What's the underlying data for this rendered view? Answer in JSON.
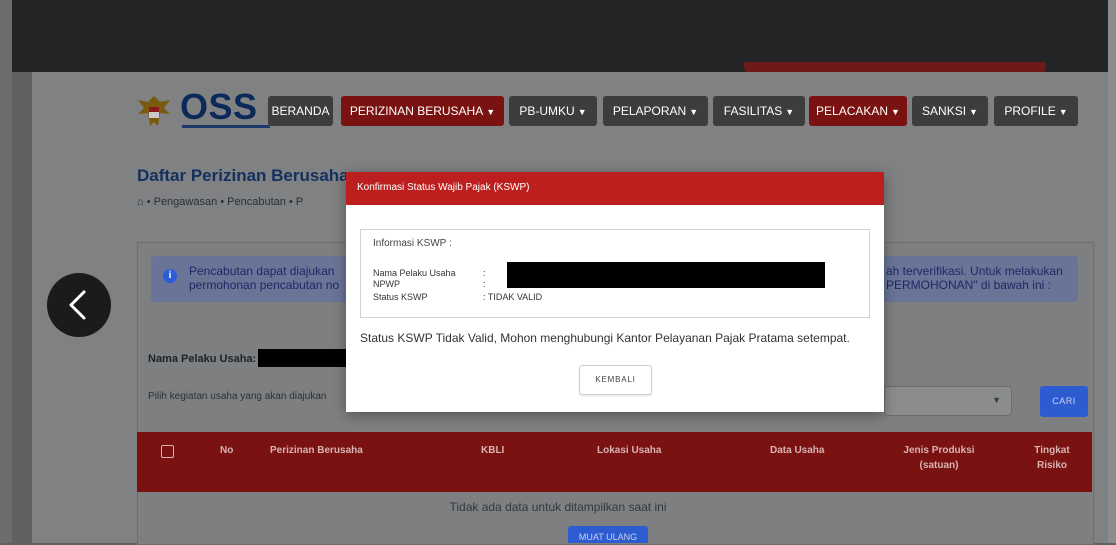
{
  "nav": {
    "items": [
      {
        "label": "BERANDA",
        "caret": false
      },
      {
        "label": "PERIZINAN BERUSAHA",
        "caret": true
      },
      {
        "label": "PB-UMKU",
        "caret": true
      },
      {
        "label": "PELAPORAN",
        "caret": true
      },
      {
        "label": "FASILITAS",
        "caret": true
      },
      {
        "label": "PELACAKAN",
        "caret": true
      },
      {
        "label": "SANKSI",
        "caret": true
      },
      {
        "label": "PROFILE",
        "caret": true
      }
    ],
    "logo_text": "OSS"
  },
  "page": {
    "title": "Daftar Perizinan Berusaha",
    "breadcrumb": "⌂ • Pengawasan • Pencabutan • P",
    "info_left_line1": "Pencabutan dapat diajukan",
    "info_left_line2": "permohonan pencabutan no",
    "info_right_line1": "ah terverifikasi. Untuk melakukan",
    "info_right_line2": "PERMOHONAN\" di bawah ini :",
    "nama_label": "Nama Pelaku Usaha:",
    "pilih_label": "Pilih kegiatan usaha yang akan diajukan",
    "cari_label": "CARI",
    "table_headers": [
      "No",
      "Perizinan Berusaha",
      "KBLI",
      "Lokasi Usaha",
      "Data Usaha",
      "Jenis Produksi",
      "(satuan)",
      "Tingkat",
      "Risiko"
    ],
    "empty_text": "Tidak ada data untuk ditampilkan saat ini",
    "muat_ulang": "MUAT ULANG"
  },
  "modal": {
    "title": "Konfirmasi Status Wajib Pajak (KSWP)",
    "box_title": "Informasi KSWP :",
    "fields": [
      {
        "key": "Nama Pelaku Usaha",
        "value": ":"
      },
      {
        "key": "NPWP",
        "value": ":"
      },
      {
        "key": "Status KSWP",
        "value": ": TIDAK VALID"
      }
    ],
    "message": "Status KSWP Tidak Valid, Mohon menghubungi Kantor Pelayanan Pajak Pratama setempat.",
    "button": "KEMBALI"
  },
  "colors": {
    "modal_header": "#bd1f1f",
    "nav_red": "#7a1212",
    "nav_gray": "#3d3d3d",
    "primary_blue": "#2d5bd0"
  },
  "icons": [
    "chevron-left-icon",
    "info-icon",
    "home-icon",
    "chevron-down-icon",
    "garuda-emblem-icon"
  ]
}
